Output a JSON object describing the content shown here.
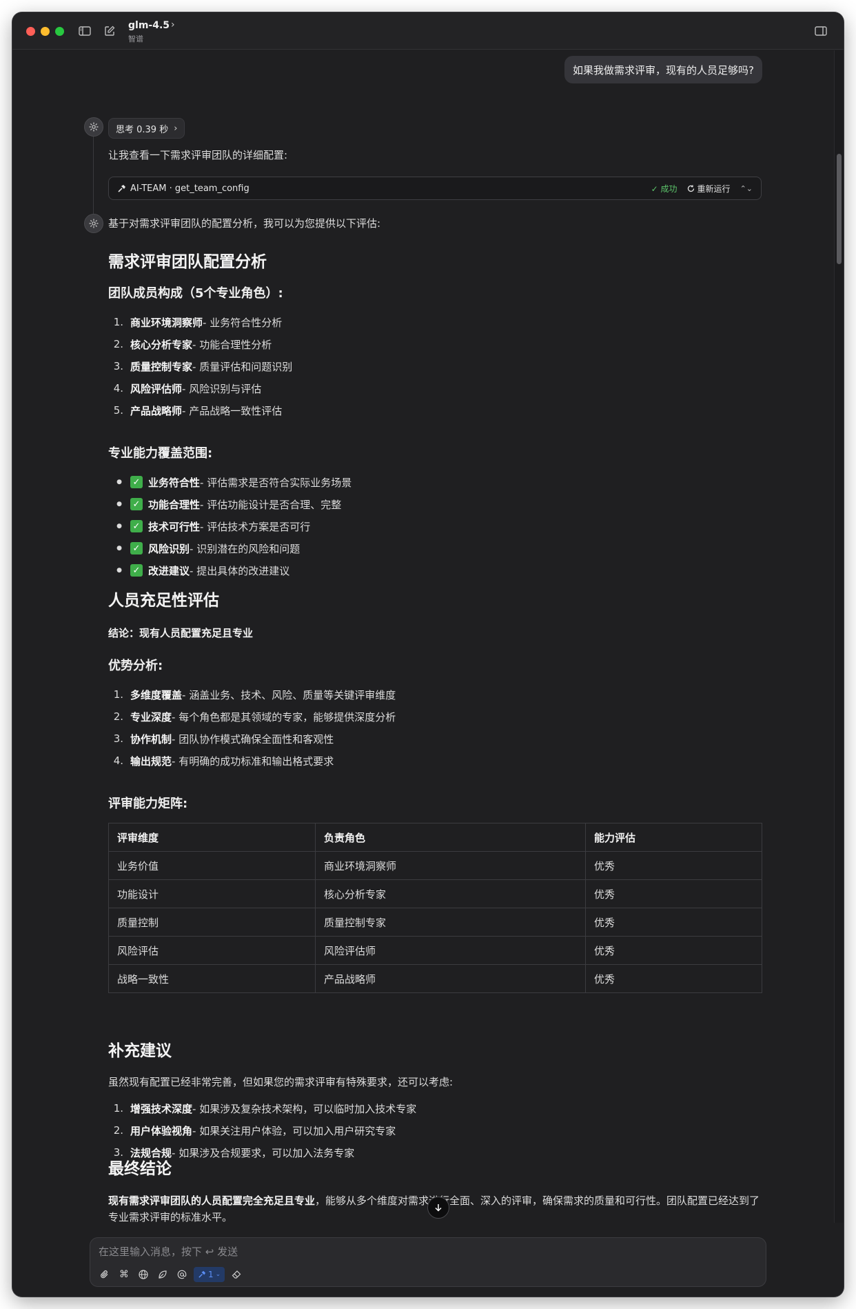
{
  "titlebar": {
    "model_name": "glm-4.5",
    "provider": "智谱",
    "chevron": "›"
  },
  "colors": {
    "close": "#ff5f57",
    "minimize": "#febc2e",
    "zoom": "#28c840",
    "success": "#5cc46a",
    "check_bg": "#3fae4a",
    "accent": "#5b8ef5"
  },
  "user_message": "如果我做需求评审，现有的人员足够吗?",
  "thinking": {
    "label": "思考 0.39 秒"
  },
  "assistant_intro": "让我查看一下需求评审团队的详细配置:",
  "tool_call": {
    "name": "AI-TEAM · get_team_config",
    "status": "✓ 成功",
    "rerun": "重新运行",
    "toggle": "⌃⌄"
  },
  "assistant_lead": "基于对需求评审团队的配置分析，我可以为您提供以下评估:",
  "section1": {
    "title": "需求评审团队配置分析",
    "members_heading": "团队成员构成（5个专业角色）:",
    "members": [
      {
        "num": "1.",
        "name": "商业环境洞察师",
        "desc": " - 业务符合性分析"
      },
      {
        "num": "2.",
        "name": "核心分析专家",
        "desc": " - 功能合理性分析"
      },
      {
        "num": "3.",
        "name": "质量控制专家",
        "desc": " - 质量评估和问题识别"
      },
      {
        "num": "4.",
        "name": "风险评估师",
        "desc": " - 风险识别与评估"
      },
      {
        "num": "5.",
        "name": "产品战略师",
        "desc": " - 产品战略一致性评估"
      }
    ],
    "coverage_heading": "专业能力覆盖范围:",
    "coverage": [
      {
        "check": "✓",
        "name": "业务符合性",
        "desc": " - 评估需求是否符合实际业务场景"
      },
      {
        "check": "✓",
        "name": "功能合理性",
        "desc": " - 评估功能设计是否合理、完整"
      },
      {
        "check": "✓",
        "name": "技术可行性",
        "desc": " - 评估技术方案是否可行"
      },
      {
        "check": "✓",
        "name": "风险识别",
        "desc": " - 识别潜在的风险和问题"
      },
      {
        "check": "✓",
        "name": "改进建议",
        "desc": " - 提出具体的改进建议"
      }
    ]
  },
  "section2": {
    "title": "人员充足性评估",
    "conclusion": "结论：现有人员配置充足且专业",
    "advantages_heading": "优势分析:",
    "advantages": [
      {
        "num": "1.",
        "name": "多维度覆盖",
        "desc": " - 涵盖业务、技术、风险、质量等关键评审维度"
      },
      {
        "num": "2.",
        "name": "专业深度",
        "desc": " - 每个角色都是其领域的专家，能够提供深度分析"
      },
      {
        "num": "3.",
        "name": "协作机制",
        "desc": " - 团队协作模式确保全面性和客观性"
      },
      {
        "num": "4.",
        "name": "输出规范",
        "desc": " - 有明确的成功标准和输出格式要求"
      }
    ],
    "matrix_heading": "评审能力矩阵:",
    "matrix": {
      "headers": [
        "评审维度",
        "负责角色",
        "能力评估"
      ],
      "rows": [
        [
          "业务价值",
          "商业环境洞察师",
          "优秀"
        ],
        [
          "功能设计",
          "核心分析专家",
          "优秀"
        ],
        [
          "质量控制",
          "质量控制专家",
          "优秀"
        ],
        [
          "风险评估",
          "风险评估师",
          "优秀"
        ],
        [
          "战略一致性",
          "产品战略师",
          "优秀"
        ]
      ]
    }
  },
  "section3": {
    "title": "补充建议",
    "intro": "虽然现有配置已经非常完善，但如果您的需求评审有特殊要求，还可以考虑:",
    "items": [
      {
        "num": "1.",
        "name": "增强技术深度",
        "desc": " - 如果涉及复杂技术架构，可以临时加入技术专家"
      },
      {
        "num": "2.",
        "name": "用户体验视角",
        "desc": " - 如果关注用户体验，可以加入用户研究专家"
      },
      {
        "num": "3.",
        "name": "法规合规",
        "desc": " - 如果涉及合规要求，可以加入法务专家"
      }
    ]
  },
  "section4": {
    "title": "最终结论",
    "bold": "现有需求评审团队的人员配置完全充足且专业",
    "rest": "，能够从多个维度对需求进行全面、深入的评审，确保需求的质量和可行性。团队配置已经达到了专业需求评审的标准水平。"
  },
  "composer": {
    "placeholder": "在这里输入消息，按下 ↩ 发送",
    "tool_count": "1",
    "icons": [
      "paperclip-icon",
      "command-icon",
      "globe-icon",
      "leaf-icon",
      "at-icon",
      "hammer-icon",
      "eraser-icon"
    ]
  }
}
